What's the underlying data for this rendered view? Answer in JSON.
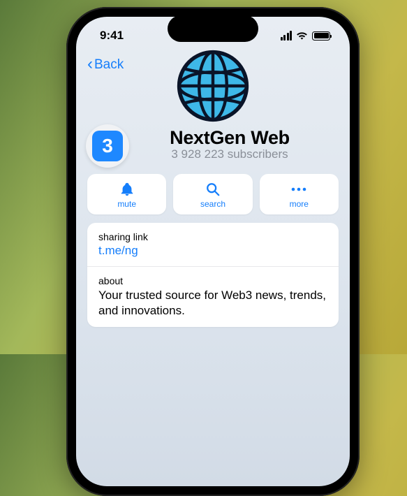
{
  "status": {
    "time": "9:41"
  },
  "nav": {
    "back_label": "Back"
  },
  "profile": {
    "name": "NextGen Web",
    "subscribers": "3 928 223 subscribers",
    "avatar_glyph": "3"
  },
  "actions": {
    "mute": "mute",
    "search": "search",
    "more": "more"
  },
  "info": {
    "sharing_label": "sharing link",
    "sharing_link": "t.me/ng",
    "about_label": "about",
    "about_text": "Your trusted source for Web3 news, trends, and innovations."
  }
}
